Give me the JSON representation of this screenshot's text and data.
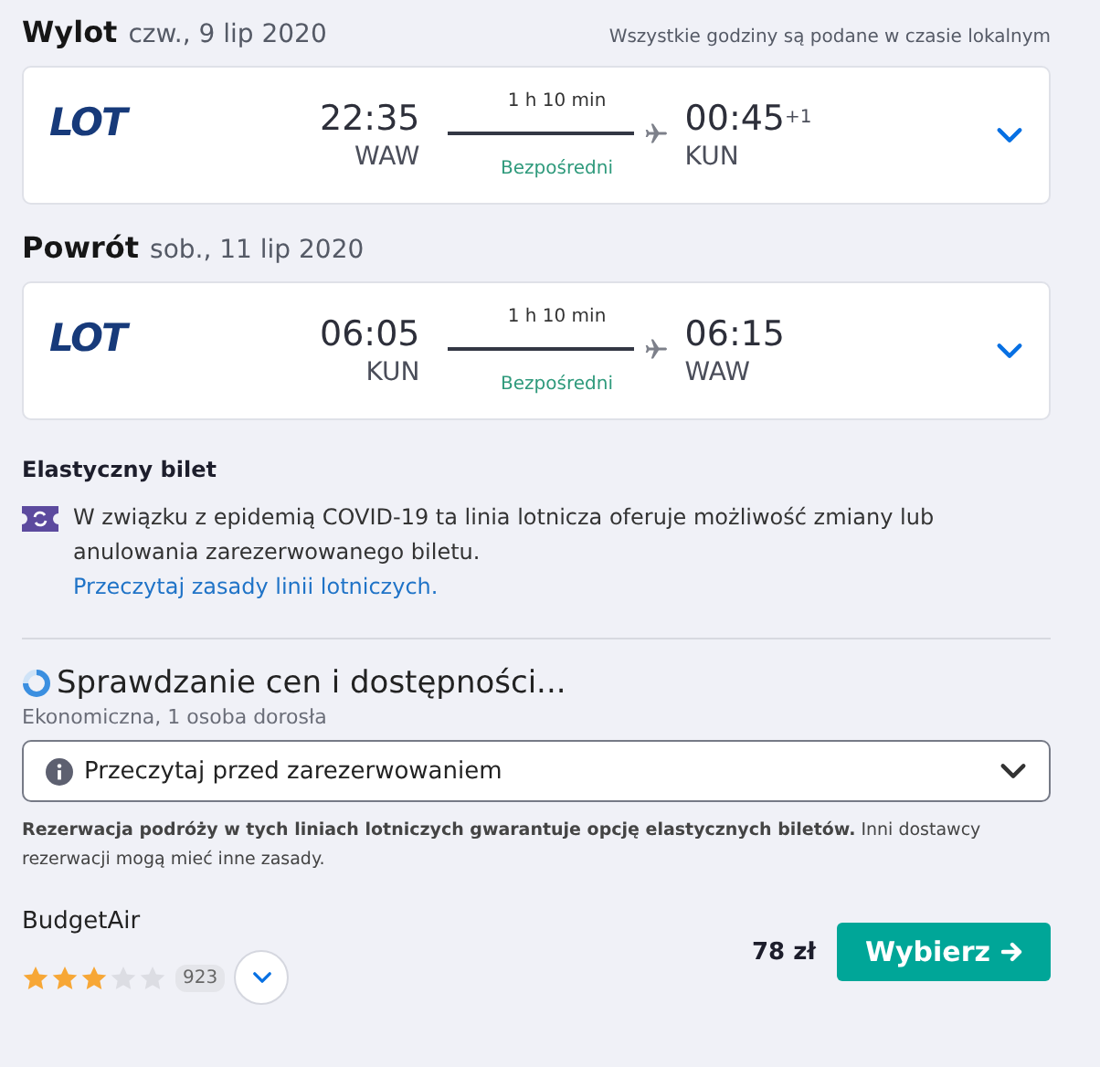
{
  "legs": [
    {
      "title": "Wylot",
      "date": "czw., 9 lip 2020",
      "note": "Wszystkie godziny są podane w czasie lokalnym",
      "airline_logo": "LOT",
      "depart_time": "22:35",
      "depart_airport": "WAW",
      "duration": "1 h 10 min",
      "stops": "Bezpośredni",
      "arrive_time": "00:45",
      "day_offset": "+1",
      "arrive_airport": "KUN"
    },
    {
      "title": "Powrót",
      "date": "sob., 11 lip 2020",
      "airline_logo": "LOT",
      "depart_time": "06:05",
      "depart_airport": "KUN",
      "duration": "1 h 10 min",
      "stops": "Bezpośredni",
      "arrive_time": "06:15",
      "arrive_airport": "WAW"
    }
  ],
  "flexible": {
    "title": "Elastyczny bilet",
    "text": "W związku z epidemią COVID-19 ta linia lotnicza oferuje możliwość zmiany lub anulowania zarezerwowanego biletu.",
    "link": "Przeczytaj zasady linii lotniczych."
  },
  "pricing": {
    "status": "Sprawdzanie cen i dostępności...",
    "cabin": "Ekonomiczna, 1 osoba dorosła",
    "dropdown": "Przeczytaj przed zarezerwowaniem",
    "notice": "**Rezerwacja podróży w tych liniach lotniczych gwarantuje opcję elastycznych biletów.** Inni dostawcy rezerwacji mogą mieć inne zasady."
  },
  "provider": {
    "name": "BudgetAir",
    "stars": 3,
    "reviews": "923",
    "price": "78 zł",
    "button": "Wybierz"
  }
}
